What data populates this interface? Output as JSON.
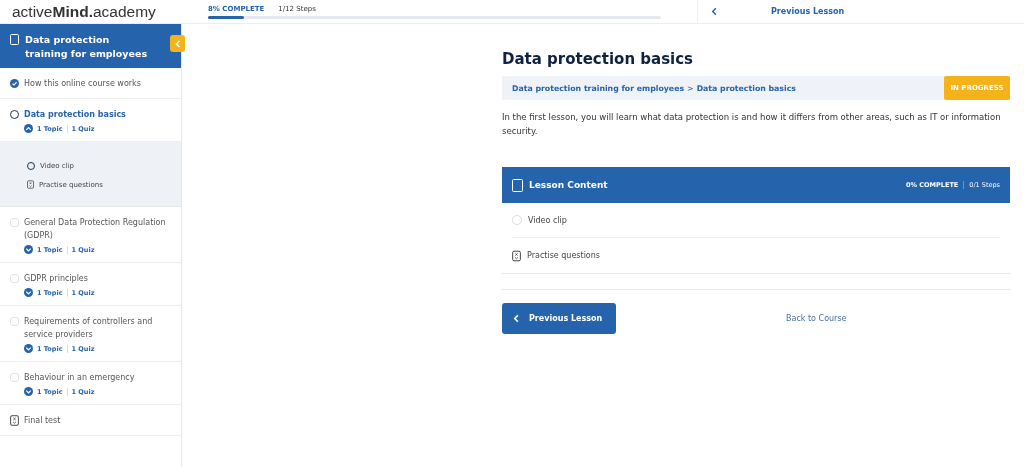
{
  "logo": {
    "light": "active",
    "bold": "Mind",
    "dot": ".",
    "rest": "academy"
  },
  "progress": {
    "label": "8% COMPLETE",
    "steps": "1/12 Steps",
    "level": 0.08
  },
  "top_nav": {
    "previous": "Previous Lesson"
  },
  "sidebar": {
    "title": "Data protection training for employees",
    "items": [
      {
        "kind": "lesson",
        "title": "How this online course works",
        "complete": true,
        "selected": false
      },
      {
        "kind": "lesson",
        "title": "Data protection basics",
        "complete": false,
        "selected": true,
        "expanded": true,
        "topics": "1 Topic",
        "quizzes": "1 Quiz",
        "children": [
          {
            "kind": "topic",
            "title": "Video clip"
          },
          {
            "kind": "quiz",
            "title": "Practise questions"
          }
        ]
      },
      {
        "kind": "lesson",
        "title": "General Data Protection Regulation (GDPR)",
        "complete": false,
        "selected": false,
        "expanded": false,
        "topics": "1 Topic",
        "quizzes": "1 Quiz"
      },
      {
        "kind": "lesson",
        "title": "GDPR principles",
        "complete": false,
        "selected": false,
        "expanded": false,
        "topics": "1 Topic",
        "quizzes": "1 Quiz"
      },
      {
        "kind": "lesson",
        "title": "Requirements of controllers and service providers",
        "complete": false,
        "selected": false,
        "expanded": false,
        "topics": "1 Topic",
        "quizzes": "1 Quiz"
      },
      {
        "kind": "lesson",
        "title": "Behaviour in an emergency",
        "complete": false,
        "selected": false,
        "expanded": false,
        "topics": "1 Topic",
        "quizzes": "1 Quiz"
      },
      {
        "kind": "quiz",
        "title": "Final test",
        "selected": false
      }
    ]
  },
  "lesson": {
    "title": "Data protection basics",
    "breadcrumb": [
      "Data protection training for employees",
      "Data protection basics"
    ],
    "separator": ">",
    "status_badge": "IN PROGRESS",
    "description": "In the first lesson, you will learn what data protection is and how it differs from other areas, such as IT or information security.",
    "content": {
      "title": "Lesson Content",
      "complete": "0% COMPLETE",
      "steps": "0/1 Steps",
      "items": [
        {
          "kind": "topic",
          "title": "Video clip"
        },
        {
          "kind": "quiz",
          "title": "Practise questions"
        }
      ]
    },
    "previous_button": "Previous Lesson",
    "back_link": "Back to Course"
  }
}
